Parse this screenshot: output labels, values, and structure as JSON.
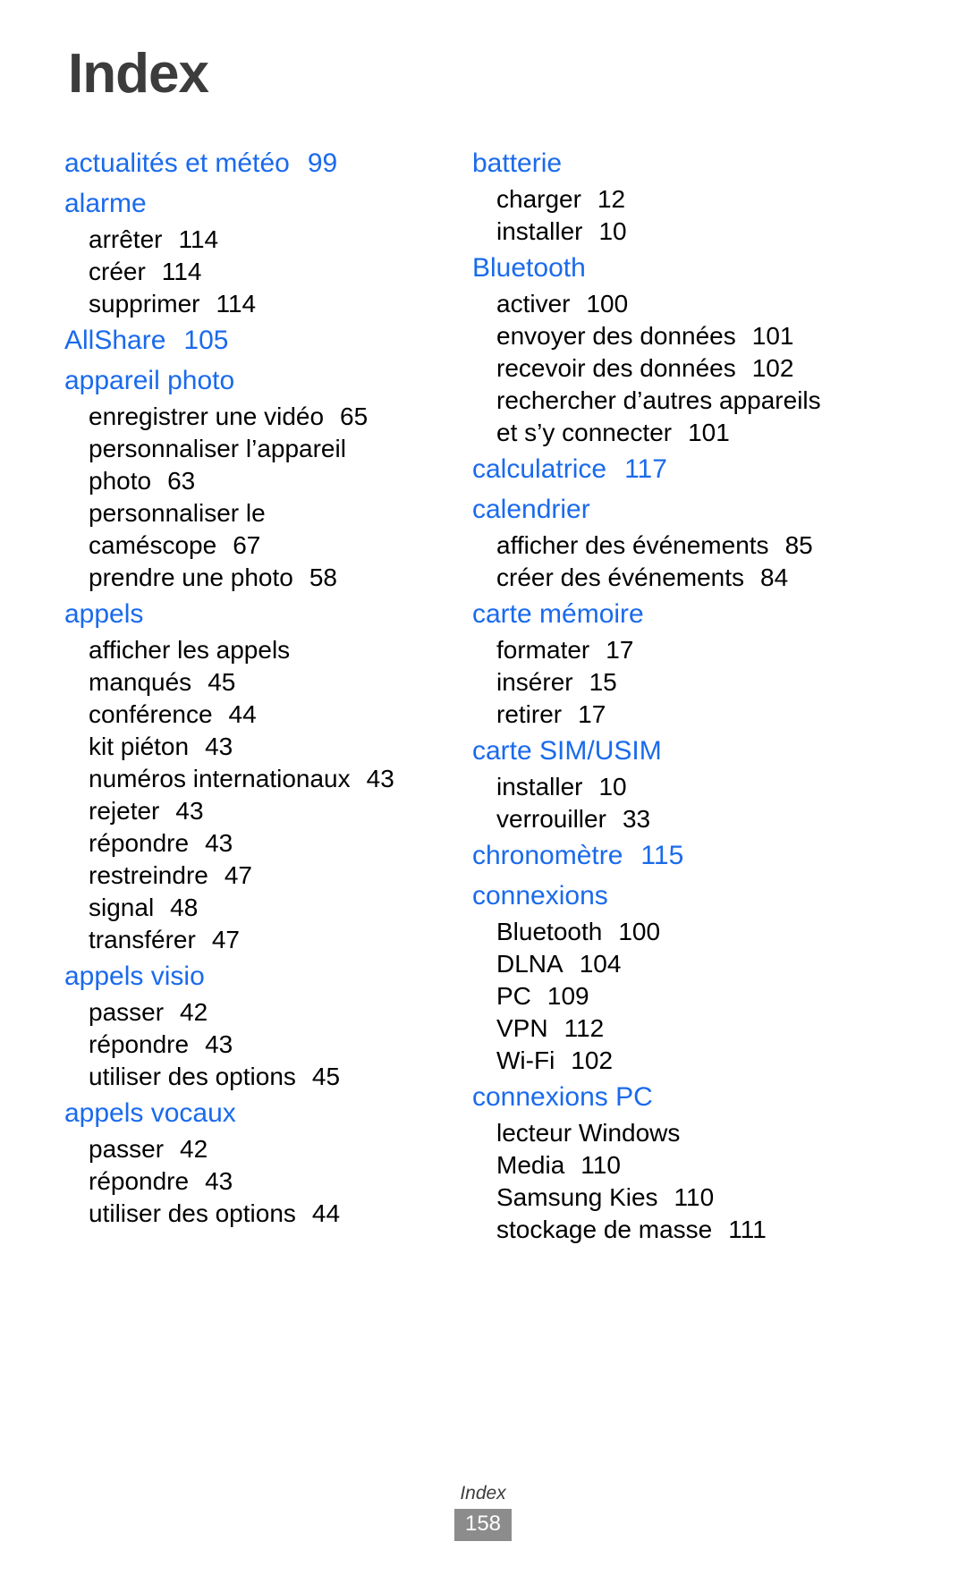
{
  "document": {
    "title": "Index",
    "footer_label": "Index",
    "footer_page": "158",
    "accent_color": "#1a6aec",
    "title_color": "#3c3c3c",
    "footer_badge_color": "#8c8c8c"
  },
  "columns": [
    {
      "name": "left-column",
      "groups": [
        {
          "heading": "actualités et météo",
          "heading_page": "99",
          "subentries": []
        },
        {
          "heading": "alarme",
          "heading_page": "",
          "subentries": [
            {
              "label": "arrêter",
              "page": "114"
            },
            {
              "label": "créer",
              "page": "114"
            },
            {
              "label": "supprimer",
              "page": "114"
            }
          ]
        },
        {
          "heading": "AllShare",
          "heading_page": "105",
          "subentries": []
        },
        {
          "heading": "appareil photo",
          "heading_page": "",
          "subentries": [
            {
              "label": "enregistrer une vidéo",
              "page": "65"
            },
            {
              "label": "personnaliser l’appareil",
              "page": ""
            },
            {
              "label": "photo",
              "page": "63"
            },
            {
              "label": "personnaliser le",
              "page": ""
            },
            {
              "label": "caméscope",
              "page": "67"
            },
            {
              "label": "prendre une photo",
              "page": "58"
            }
          ]
        },
        {
          "heading": "appels",
          "heading_page": "",
          "subentries": [
            {
              "label": "afficher les appels",
              "page": ""
            },
            {
              "label": "manqués",
              "page": "45"
            },
            {
              "label": "conférence",
              "page": "44"
            },
            {
              "label": "kit piéton",
              "page": "43"
            },
            {
              "label": "numéros internationaux",
              "page": "43"
            },
            {
              "label": "rejeter",
              "page": "43"
            },
            {
              "label": "répondre",
              "page": "43"
            },
            {
              "label": "restreindre",
              "page": "47"
            },
            {
              "label": "signal",
              "page": "48"
            },
            {
              "label": "transférer",
              "page": "47"
            }
          ]
        },
        {
          "heading": "appels visio",
          "heading_page": "",
          "subentries": [
            {
              "label": "passer",
              "page": "42"
            },
            {
              "label": "répondre",
              "page": "43"
            },
            {
              "label": "utiliser des options",
              "page": "45"
            }
          ]
        },
        {
          "heading": "appels vocaux",
          "heading_page": "",
          "subentries": [
            {
              "label": "passer",
              "page": "42"
            },
            {
              "label": "répondre",
              "page": "43"
            },
            {
              "label": "utiliser des options",
              "page": "44"
            }
          ]
        }
      ]
    },
    {
      "name": "right-column",
      "groups": [
        {
          "heading": "batterie",
          "heading_page": "",
          "subentries": [
            {
              "label": "charger",
              "page": "12"
            },
            {
              "label": "installer",
              "page": "10"
            }
          ]
        },
        {
          "heading": "Bluetooth",
          "heading_page": "",
          "subentries": [
            {
              "label": "activer",
              "page": "100"
            },
            {
              "label": "envoyer des données",
              "page": "101"
            },
            {
              "label": "recevoir des données",
              "page": "102"
            },
            {
              "label": "rechercher d’autres appareils",
              "page": ""
            },
            {
              "label": "et s’y connecter",
              "page": "101"
            }
          ]
        },
        {
          "heading": "calculatrice",
          "heading_page": "117",
          "subentries": []
        },
        {
          "heading": "calendrier",
          "heading_page": "",
          "subentries": [
            {
              "label": "afficher des événements",
              "page": "85"
            },
            {
              "label": "créer des événements",
              "page": "84"
            }
          ]
        },
        {
          "heading": "carte mémoire",
          "heading_page": "",
          "subentries": [
            {
              "label": "formater",
              "page": "17"
            },
            {
              "label": "insérer",
              "page": "15"
            },
            {
              "label": "retirer",
              "page": "17"
            }
          ]
        },
        {
          "heading": "carte SIM/USIM",
          "heading_page": "",
          "subentries": [
            {
              "label": "installer",
              "page": "10"
            },
            {
              "label": "verrouiller",
              "page": "33"
            }
          ]
        },
        {
          "heading": "chronomètre",
          "heading_page": "115",
          "subentries": []
        },
        {
          "heading": "connexions",
          "heading_page": "",
          "subentries": [
            {
              "label": "Bluetooth",
              "page": "100"
            },
            {
              "label": "DLNA",
              "page": "104"
            },
            {
              "label": "PC",
              "page": "109"
            },
            {
              "label": "VPN",
              "page": "112"
            },
            {
              "label": "Wi-Fi",
              "page": "102"
            }
          ]
        },
        {
          "heading": "connexions PC",
          "heading_page": "",
          "subentries": [
            {
              "label": "lecteur Windows",
              "page": ""
            },
            {
              "label": "Media",
              "page": "110"
            },
            {
              "label": "Samsung Kies",
              "page": "110"
            },
            {
              "label": "stockage de masse",
              "page": "111"
            }
          ]
        }
      ]
    }
  ]
}
